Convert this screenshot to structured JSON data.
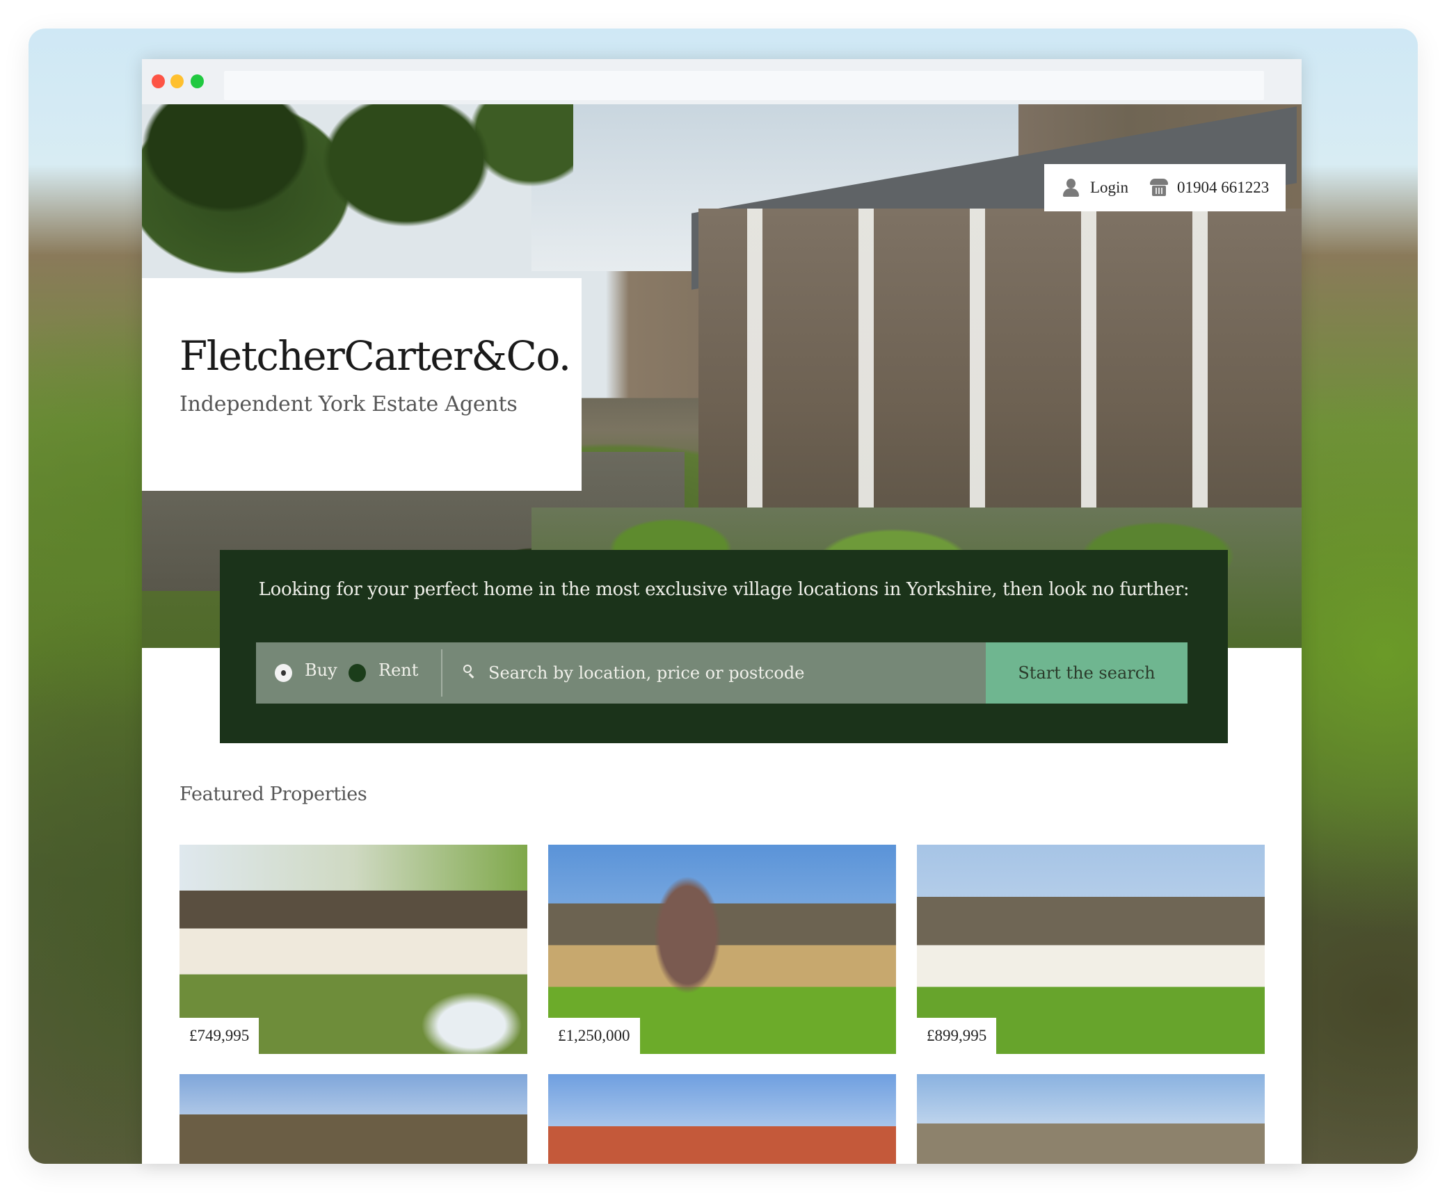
{
  "browser": {
    "window_controls": [
      "close",
      "minimize",
      "maximize"
    ],
    "url": ""
  },
  "header": {
    "login_label": "Login",
    "login_icon": "user-icon",
    "phone_number": "01904 661223",
    "phone_icon": "telephone-icon"
  },
  "brand": {
    "name": "FletcherCarter&Co.",
    "tagline": "Independent York Estate Agents"
  },
  "search": {
    "intro": "Looking for your perfect home in the most exclusive village locations in Yorkshire, then look no further:",
    "options": [
      {
        "label": "Buy",
        "selected": true
      },
      {
        "label": "Rent",
        "selected": false
      }
    ],
    "placeholder": "Search by location, price or postcode",
    "value": "",
    "button_label": "Start the search",
    "colors": {
      "panel": "#1b331a",
      "bar": "#768877",
      "button": "#6fb690"
    }
  },
  "featured": {
    "title": "Featured Properties",
    "properties": [
      {
        "price": "£749,995"
      },
      {
        "price": "£1,250,000"
      },
      {
        "price": "£899,995"
      },
      {
        "price": ""
      },
      {
        "price": ""
      },
      {
        "price": ""
      }
    ]
  }
}
